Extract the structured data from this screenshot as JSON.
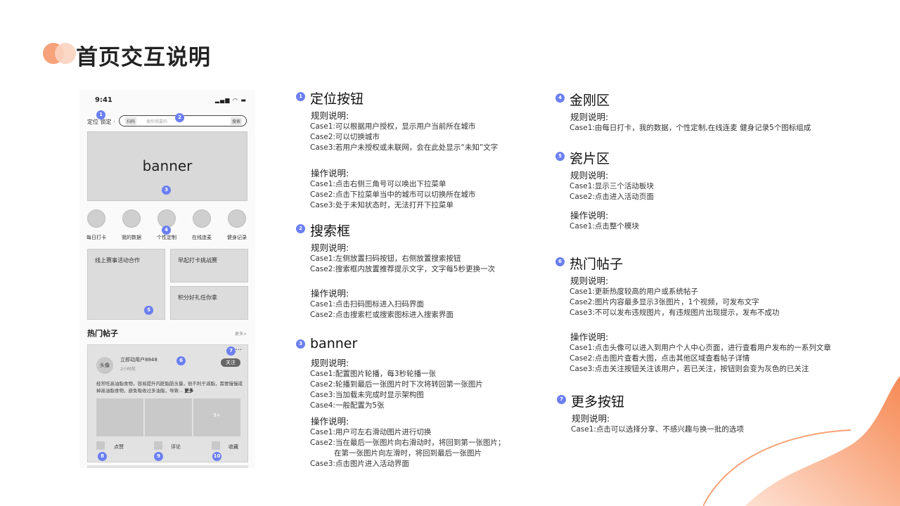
{
  "page_title": "首页交互说明",
  "phone": {
    "time": "9:41",
    "status_icons": "▂▄▆ ◠ ▬",
    "location": "定位 锁定 ·",
    "scan": "扫码",
    "search_placeholder": "搜你想要的",
    "search_btn": "搜索",
    "banner": "banner",
    "kingkong": [
      "每日打卡",
      "我的数据",
      "个性定制",
      "在线连麦",
      "健身记录"
    ],
    "tiles": [
      "线上赛事活动合作",
      "早起打卡挑战赛",
      "积分好礼任你拿"
    ],
    "hot_title": "热门帖子",
    "hot_more": "更多>",
    "post": {
      "avatar": "头像",
      "user": "立即动用户8848",
      "time": "2小时前",
      "follow": "关注",
      "more_dots": "···",
      "text": "经常吃高油脂食物，容易提升内脏脂肪含量，很不利于减脂，需要慢慢戒掉高油脂食物，避免吸收过多油脂，导致...",
      "text_more": "更多",
      "img_more": "9+",
      "like": "点赞",
      "comment": "评论",
      "collect": "收藏"
    }
  },
  "markers": [
    "1",
    "2",
    "3",
    "4",
    "5",
    "6",
    "7",
    "8",
    "9",
    "10"
  ],
  "sections": {
    "s1": {
      "num": "1",
      "title": "定位按钮",
      "rule_label": "规则说明:",
      "rules": [
        "Case1:可以根据用户授权，显示用户当前所在城市",
        "Case2:可以切换城市",
        "Case3:若用户未授权或未联网，会在此处显示“未知”文字"
      ],
      "op_label": "操作说明:",
      "ops": [
        "Case1:点击右侧三角号可以唤出下拉菜单",
        "Case2:点击下拉菜单当中的城市可以切换所在城市",
        "Case3:处于未知状态时，无法打开下拉菜单"
      ]
    },
    "s2": {
      "num": "2",
      "title": "搜索框",
      "rule_label": "规则说明:",
      "rules": [
        "Case1:左侧放置扫码按钮，右侧放置搜索按钮",
        "Case2:搜索框内放置推荐提示文字，文字每5秒更换一次"
      ],
      "op_label": "操作说明:",
      "ops": [
        "Case1:点击扫码图标进入扫码界面",
        "Case2:点击搜索栏或搜索图标进入搜索界面"
      ]
    },
    "s3": {
      "num": "3",
      "title": "banner",
      "rule_label": "规则说明:",
      "rules": [
        "Case1:配置图片轮播，每3秒轮播一张",
        "Case2:轮播到最后一张图片时下次将转回第一张图片",
        "Case3:当加载未完成时显示架构图",
        "Case4:一般配置为5张"
      ],
      "op_label": "操作说明:",
      "ops": [
        "Case1:用户可左右滑动图片进行切换",
        "Case2:当在最后一张图片向右滑动时，将回到第一张图片；",
        "在第一张图片向左滑时，将回到最后一张图片",
        "Case3:点击图片进入活动界面"
      ]
    },
    "s4": {
      "num": "4",
      "title": "金刚区",
      "rule_label": "规则说明:",
      "rules": [
        "Case1:由每日打卡，我的数据，个性定制,在线连麦  健身记录5个图标组成"
      ]
    },
    "s5": {
      "num": "5",
      "title": "瓷片区",
      "rule_label": "规则说明:",
      "rules": [
        "Case1:显示三个活动板块",
        "Case2:点击进入活动页面"
      ],
      "op_label": "操作说明:",
      "ops": [
        "Case1:点击整个模块"
      ]
    },
    "s6": {
      "num": "6",
      "title": "热门帖子",
      "rule_label": "规则说明:",
      "rules": [
        "Case1:更新热度较高的用户或系统帖子",
        "Case2:图片内容最多显示3张图片，1个视频，可发布文字",
        "Case3:不可以发布违规图片，有违规图片出现提示，发布不成功"
      ],
      "op_label": "操作说明:",
      "ops": [
        "Case1:点击头像可以进入到用户个人中心页面，进行查看用户发布的一系列文章",
        "Case2:点击图片查看大图，点击其他区域查看帖子详情",
        "Case3:点击关注按钮关注该用户，若已关注，按钮则会变为灰色的已关注"
      ]
    },
    "s7": {
      "num": "7",
      "title": "更多按钮",
      "rule_label": "规则说明:",
      "rules": [
        "Case1:点击可以选择分享、不感兴趣与换一批的选项"
      ]
    }
  },
  "colors": {
    "accent": "#6b7ff0",
    "orange": "#f7a27a"
  }
}
